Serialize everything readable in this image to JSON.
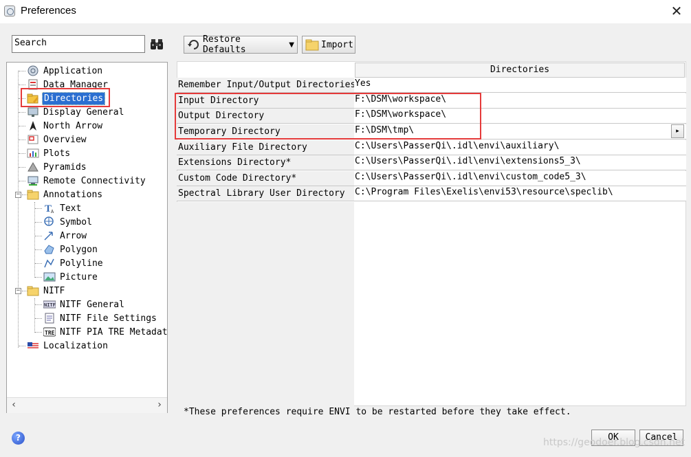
{
  "window": {
    "title": "Preferences",
    "close_glyph": "✕"
  },
  "search": {
    "placeholder": "Search"
  },
  "tree": {
    "items": [
      {
        "label": "Application",
        "icon": "application-icon"
      },
      {
        "label": "Data Manager",
        "icon": "data-manager-icon"
      },
      {
        "label": "Directories",
        "icon": "directories-icon",
        "selected": true
      },
      {
        "label": "Display General",
        "icon": "display-general-icon"
      },
      {
        "label": "North Arrow",
        "icon": "north-arrow-icon"
      },
      {
        "label": "Overview",
        "icon": "overview-icon"
      },
      {
        "label": "Plots",
        "icon": "plots-icon"
      },
      {
        "label": "Pyramids",
        "icon": "pyramids-icon"
      },
      {
        "label": "Remote Connectivity",
        "icon": "remote-connectivity-icon"
      },
      {
        "label": "Annotations",
        "icon": "folder-icon",
        "expanded": true
      },
      {
        "label": "Text",
        "icon": "text-annotation-icon"
      },
      {
        "label": "Symbol",
        "icon": "symbol-annotation-icon"
      },
      {
        "label": "Arrow",
        "icon": "arrow-annotation-icon"
      },
      {
        "label": "Polygon",
        "icon": "polygon-annotation-icon"
      },
      {
        "label": "Polyline",
        "icon": "polyline-annotation-icon"
      },
      {
        "label": "Picture",
        "icon": "picture-annotation-icon"
      },
      {
        "label": "NITF",
        "icon": "folder-icon",
        "expanded": true
      },
      {
        "label": "NITF General",
        "icon": "nitf-general-icon"
      },
      {
        "label": "NITF File Settings",
        "icon": "nitf-file-settings-icon"
      },
      {
        "label": "NITF PIA TRE Metadata",
        "icon": "nitf-tre-icon"
      },
      {
        "label": "Localization",
        "icon": "localization-icon"
      }
    ],
    "scroll_left": "‹",
    "scroll_right": "›"
  },
  "toolbar": {
    "restore_label": "Restore Defaults",
    "import_label": "Import"
  },
  "table": {
    "column_header": "Directories",
    "rows": [
      {
        "label": "Remember Input/Output Directories",
        "value": "Yes"
      },
      {
        "label": "Input Directory",
        "value": "F:\\DSM\\workspace\\"
      },
      {
        "label": "Output Directory",
        "value": "F:\\DSM\\workspace\\"
      },
      {
        "label": "Temporary Directory",
        "value": "F:\\DSM\\tmp\\"
      },
      {
        "label": "Auxiliary File Directory",
        "value": "C:\\Users\\PasserQi\\.idl\\envi\\auxiliary\\"
      },
      {
        "label": "Extensions Directory*",
        "value": "C:\\Users\\PasserQi\\.idl\\envi\\extensions5_3\\"
      },
      {
        "label": "Custom Code Directory*",
        "value": "C:\\Users\\PasserQi\\.idl\\envi\\custom_code5_3\\"
      },
      {
        "label": "Spectral Library User Directory",
        "value": "C:\\Program Files\\Exelis\\envi53\\resource\\speclib\\"
      }
    ],
    "row_arrow_glyph": "▸"
  },
  "note": "*These preferences require ENVI to be restarted before they take effect.",
  "buttons": {
    "ok": "OK",
    "cancel": "Cancel",
    "help_glyph": "?"
  },
  "watermark": "https://geodoer.blog.csdn.net",
  "colors": {
    "highlight_red": "#e53a3a",
    "selection_blue": "#2a6fd1"
  }
}
